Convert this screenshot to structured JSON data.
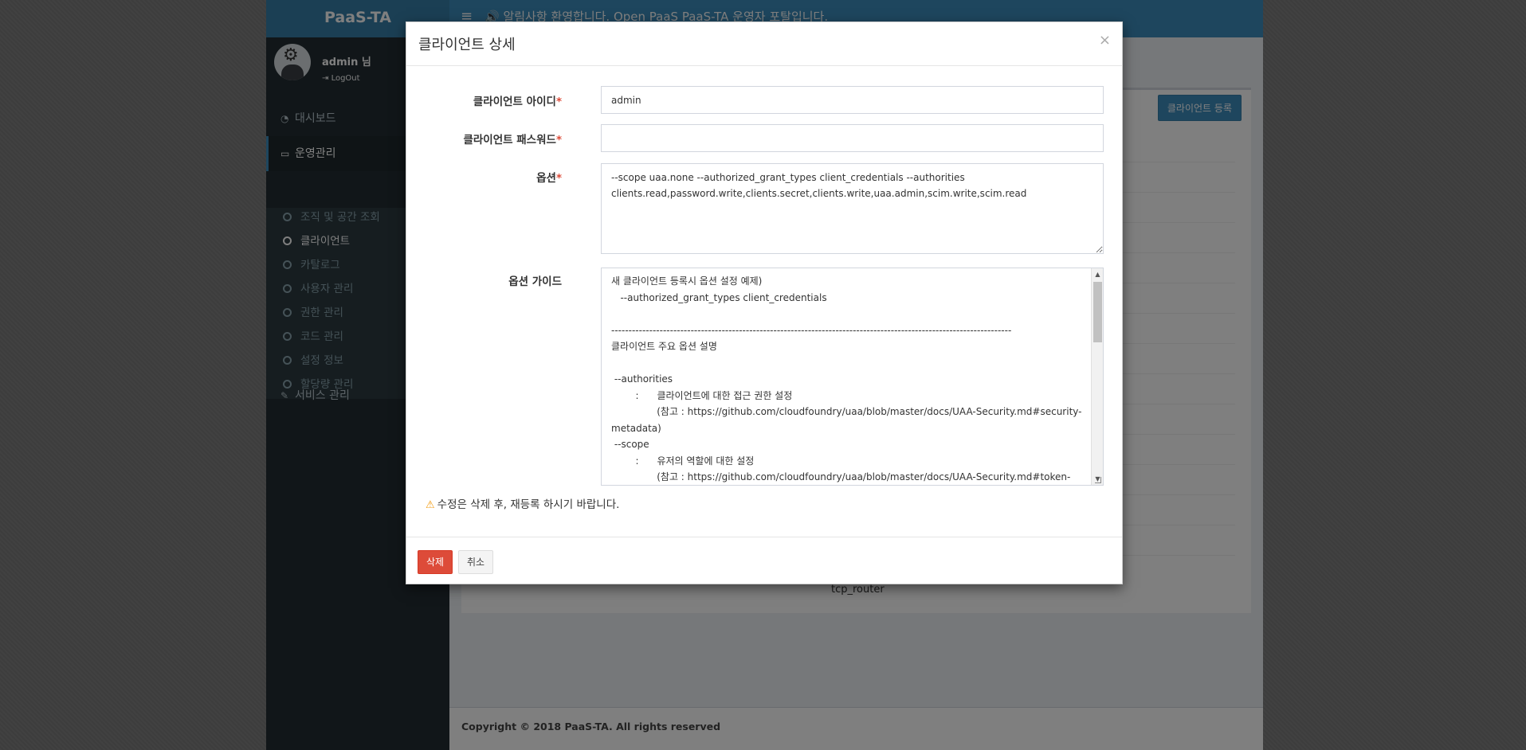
{
  "app": {
    "brand": "PaaS-TA",
    "notice": "알림사항 환영합니다. Open PaaS PaaS-TA 운영자 포탈입니다.",
    "user": {
      "name": "admin 님",
      "logout": "LogOut"
    },
    "menu": {
      "dashboard": "대시보드",
      "operations": "운영관리",
      "submenu": [
        "조직 및 공간 조회",
        "클라이언트",
        "카탈로그",
        "사용자 관리",
        "권한 관리",
        "코드 관리",
        "설정 정보",
        "할당량 관리"
      ],
      "services": "서비스 관리"
    },
    "register_button": "클라이언트 등록",
    "visible_cell": "tcp_router",
    "footer": "Copyright © 2018 PaaS-TA. All rights reserved"
  },
  "modal": {
    "title": "클라이언트 상세",
    "close": "×",
    "client_id_label": "클라이언트 아이디",
    "client_id_value": "admin",
    "password_label": "클라이언트 패스워드",
    "password_value": "",
    "option_label": "옵션",
    "option_value": "--scope uaa.none --authorized_grant_types client_credentials --authorities clients.read,password.write,clients.secret,clients.write,uaa.admin,scim.write,scim.read",
    "guide_label": "옵션 가이드",
    "guide_text": "새 클라이언트 등록시 옵션 설정 예제)\n   --authorized_grant_types client_credentials\n\n--------------------------------------------------------------------------------------------------------------------\n클라이언트 주요 옵션 설명\n\n --authorities\n        :      클라이언트에 대한 접근 권한 설정\n               (참고 : https://github.com/cloudfoundry/uaa/blob/master/docs/UAA-Security.md#security-metadata)\n --scope\n        :      유저의 역할에 대한 설정\n               (참고 : https://github.com/cloudfoundry/uaa/blob/master/docs/UAA-Security.md#token-",
    "warning": "수정은 삭제 후, 재등록 하시기 바랍니다.",
    "delete_button": "삭제",
    "cancel_button": "취소"
  }
}
